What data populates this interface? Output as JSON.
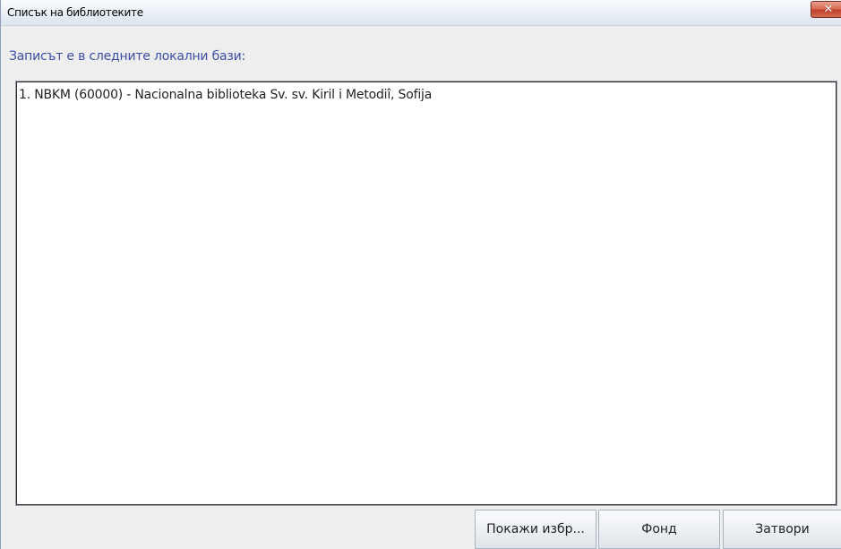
{
  "window": {
    "title": "Списък на библиотеките",
    "close_glyph": "✕"
  },
  "heading": "Записът е в следните локални бази:",
  "list": {
    "items": [
      "1. NBKM (60000) - Nacionalna biblioteka Sv. sv. Kiril i Metodiî, Sofija"
    ]
  },
  "buttons": {
    "show_label": "Покажи избр...",
    "fond_label": "Фонд",
    "close_label": "Затвори"
  },
  "colors": {
    "heading": "#3b4fa8",
    "close_button": "#c0412a",
    "window_bg": "#eeeeee"
  }
}
